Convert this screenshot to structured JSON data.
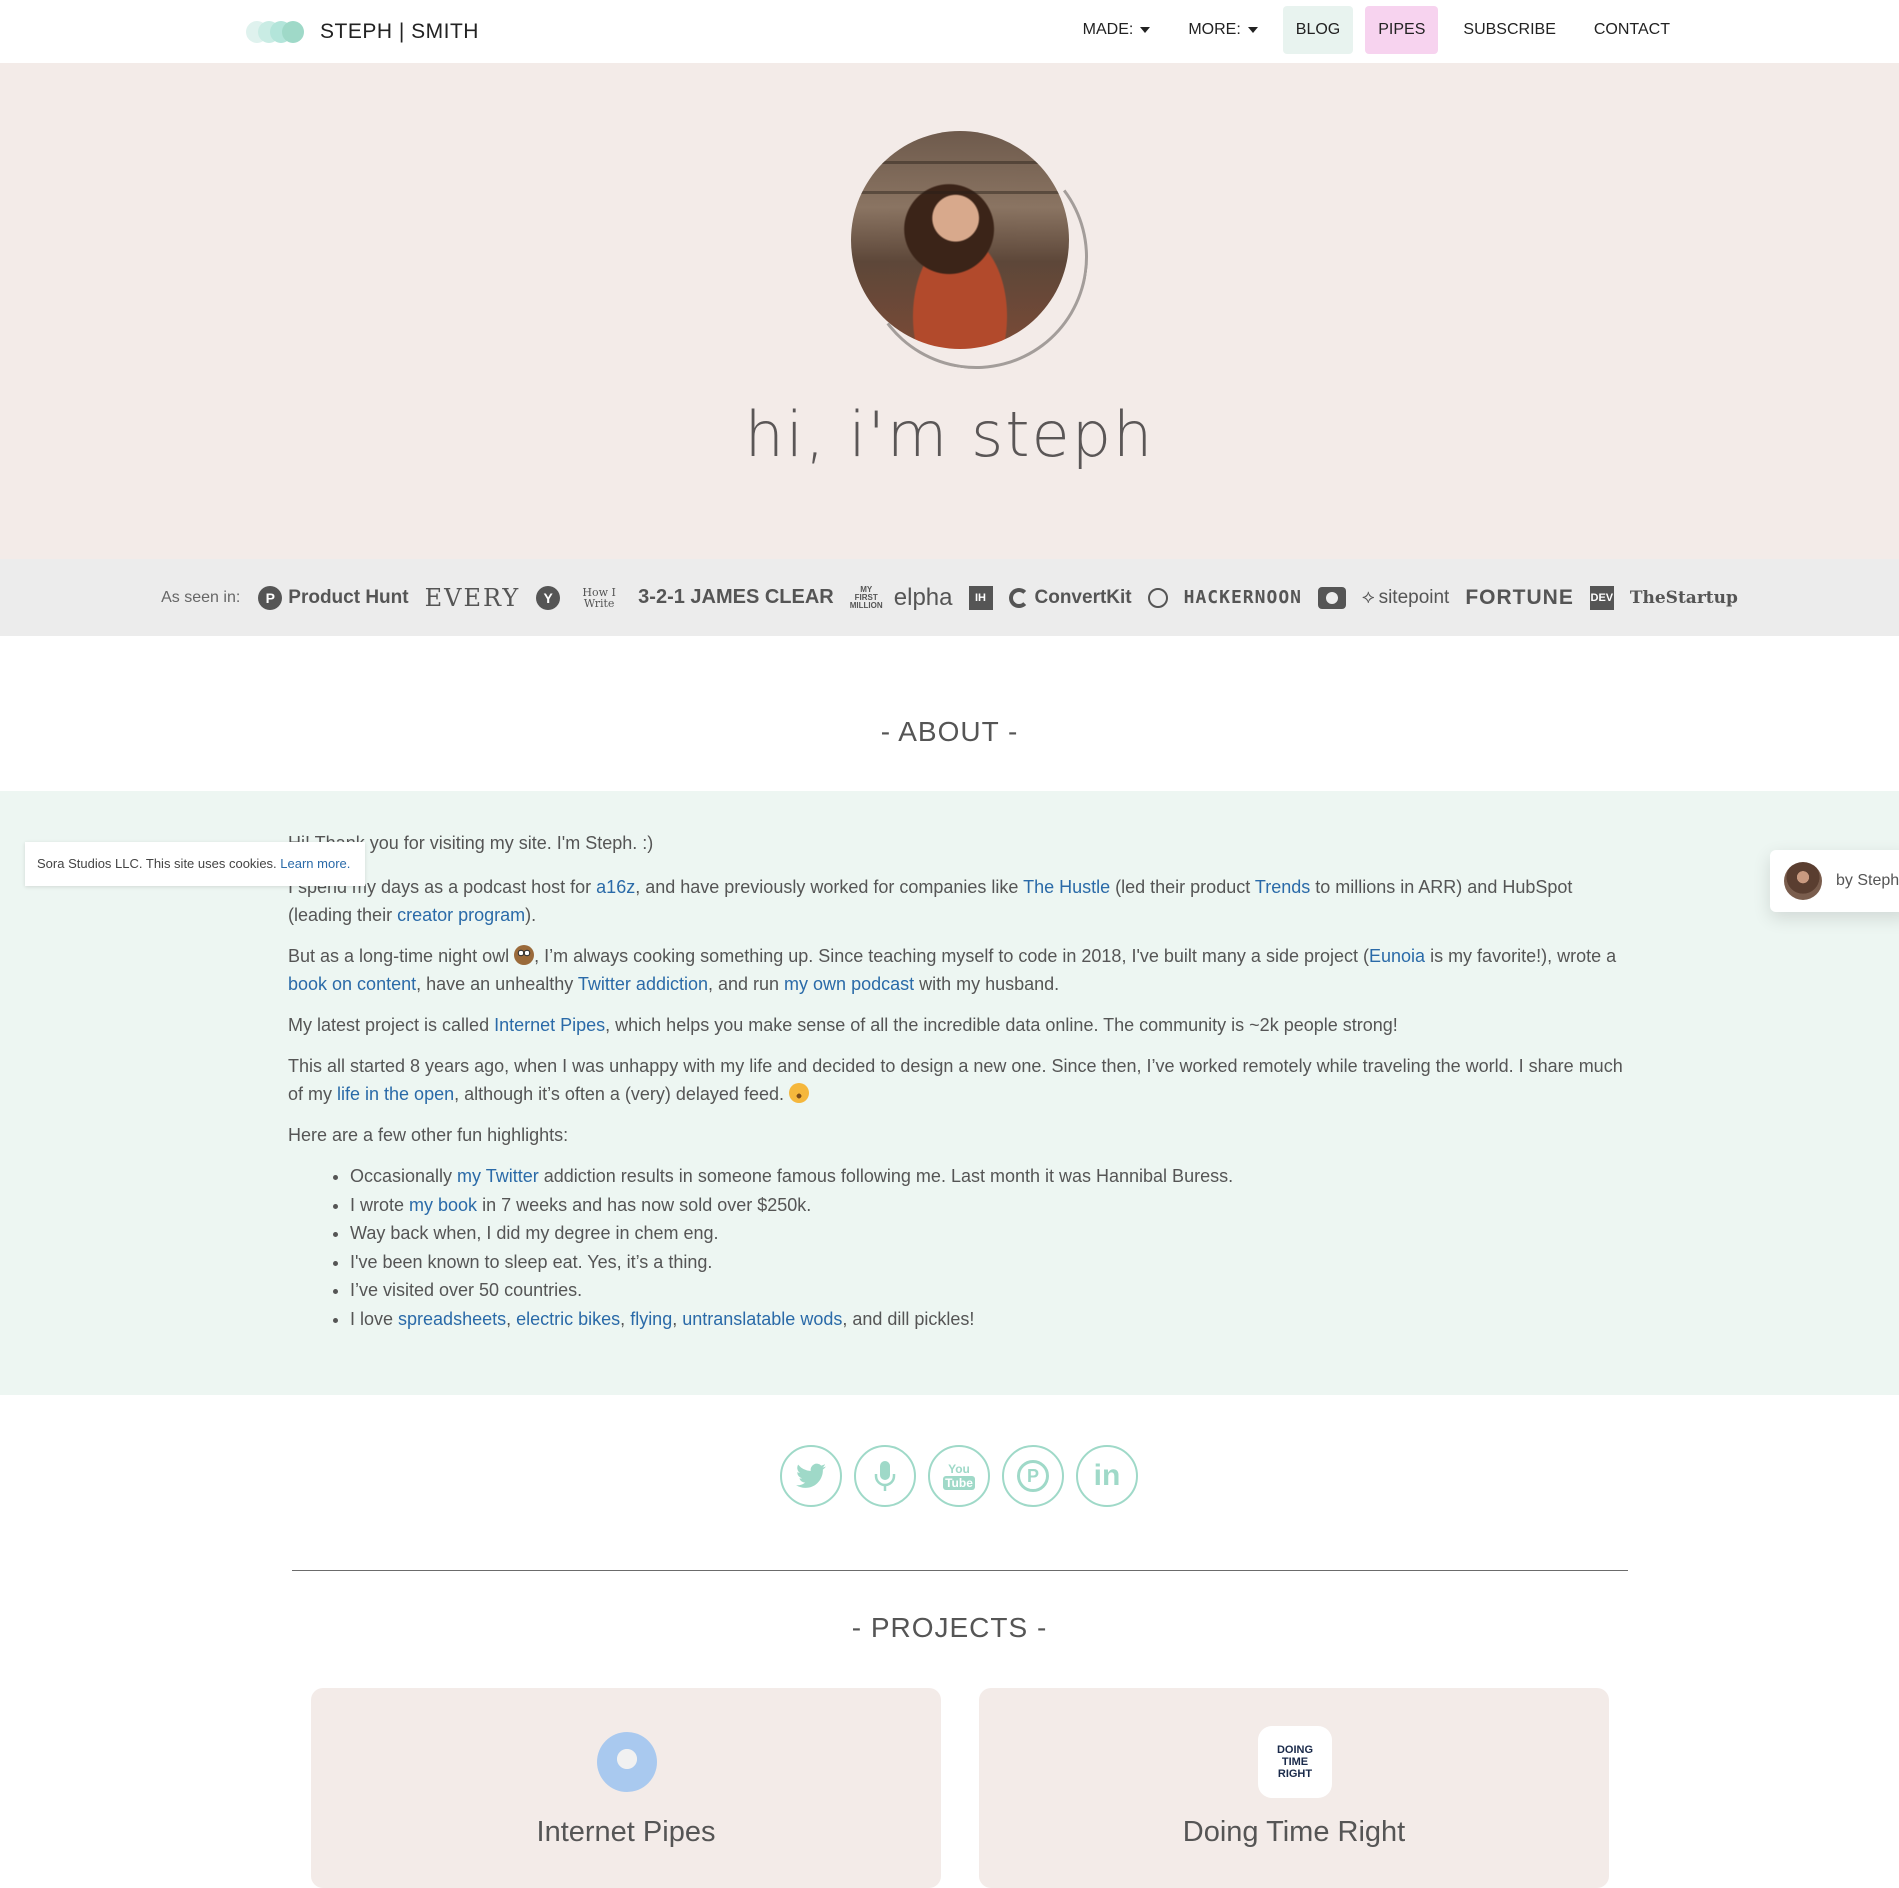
{
  "nav": {
    "logo_text": "STEPH | SMITH",
    "items": [
      {
        "label": "MADE:",
        "dropdown": true
      },
      {
        "label": "MORE:",
        "dropdown": true
      },
      {
        "label": "BLOG",
        "bg": "#e8f3ef"
      },
      {
        "label": "PIPES",
        "bg": "#f7d3ef"
      },
      {
        "label": "SUBSCRIBE"
      },
      {
        "label": "CONTACT"
      }
    ]
  },
  "hero": {
    "title": "hi, i'm steph",
    "avatar_icon": "profile-photo"
  },
  "seen_in": {
    "label": "As seen in:",
    "logos": [
      {
        "name": "Product Hunt",
        "icon": "P"
      },
      {
        "name": "EVERY"
      },
      {
        "name": "Y",
        "icon_only": true
      },
      {
        "name": "How I Write"
      },
      {
        "name": "3-2-1 JAMES CLEAR"
      },
      {
        "name": "MY FIRST MILLION"
      },
      {
        "name": "elpha"
      },
      {
        "name": "IH"
      },
      {
        "name": "ConvertKit"
      },
      {
        "name": "owl-logo-icon"
      },
      {
        "name": "HACKERNOON"
      },
      {
        "name": "camera-icon"
      },
      {
        "name": "sitepoint"
      },
      {
        "name": "FORTUNE"
      },
      {
        "name": "DEV"
      },
      {
        "name": "TheStartup"
      }
    ]
  },
  "about": {
    "title": "- ABOUT -",
    "p1": "Hi! Thank you for visiting my site. I'm Steph. :)",
    "p2": {
      "t1": "I spend my days as a podcast host for ",
      "a16z": "a16z",
      "t2": ", and have previously worked for companies like ",
      "hustle": "The Hustle",
      "t3": " (led their product ",
      "trends": "Trends",
      "t4": " to millions in ARR) and HubSpot (leading their ",
      "creator": "creator program",
      "t5": ")."
    },
    "p3": {
      "t1": "But as a long-time night owl ",
      "t2": ", I’m always cooking something up. Since teaching myself to code in 2018, I've built many a side project (",
      "eunoia": "Eunoia",
      "t3": " is my favorite!), wrote a ",
      "book": "book on content",
      "t4": ", have an unhealthy ",
      "twitter": "Twitter addiction",
      "t5": ", and run ",
      "podcast": "my own podcast",
      "t6": " with my husband."
    },
    "p4": {
      "t1": "My latest project is called ",
      "pipes": "Internet Pipes",
      "t2": ", which helps you make sense of all the incredible data online. The community is ~2k people strong!"
    },
    "p5": {
      "t1": "This all started 8 years ago, when I was unhappy with my life and decided to design a new one. Since then, I’ve worked remotely while traveling the world. I share much of my ",
      "open": "life in the open",
      "t2": ", although it’s often a (very) delayed feed. "
    },
    "p6": "Here are a few other fun highlights:",
    "li1": {
      "t1": "Occasionally ",
      "link": "my Twitter",
      "t2": " addiction results in someone famous following me. Last month it was Hannibal Buress."
    },
    "li2": {
      "t1": "I wrote ",
      "link": "my book",
      "t2": " in 7 weeks and has now sold over $250k."
    },
    "li3": "Way back when, I did my degree in chem eng.",
    "li4": "I've been known to sleep eat. Yes, it’s a thing.",
    "li5": "I’ve visited over 50 countries.",
    "li6": {
      "t1": "I love ",
      "a": "spreadsheets",
      "b": "electric bikes",
      "c": "flying",
      "d": "untranslatable wods",
      "t2": ", and dill pickles!",
      "comma": ", "
    }
  },
  "cookie": {
    "text": "Sora Studios LLC. This site uses cookies. ",
    "link": "Learn more."
  },
  "by_steph": {
    "label": "by Steph"
  },
  "social": [
    {
      "name": "twitter-icon",
      "glyph": "🐦"
    },
    {
      "name": "microphone-icon",
      "glyph": "🎙"
    },
    {
      "name": "youtube-icon",
      "glyph": "You Tube"
    },
    {
      "name": "producthunt-icon",
      "glyph": "P"
    },
    {
      "name": "linkedin-icon",
      "glyph": "in"
    }
  ],
  "projects": {
    "title": "- PROJECTS -",
    "cards": [
      {
        "title": "Internet Pipes",
        "icon": "robot-icon"
      },
      {
        "title": "Doing Time Right",
        "icon_text": "DOING TIME RIGHT"
      }
    ]
  },
  "colors": {
    "hero_bg": "#f3ebe8",
    "about_bg": "#edf6f2",
    "link": "#2a6aa8",
    "social_accent": "#9fd9c8"
  }
}
